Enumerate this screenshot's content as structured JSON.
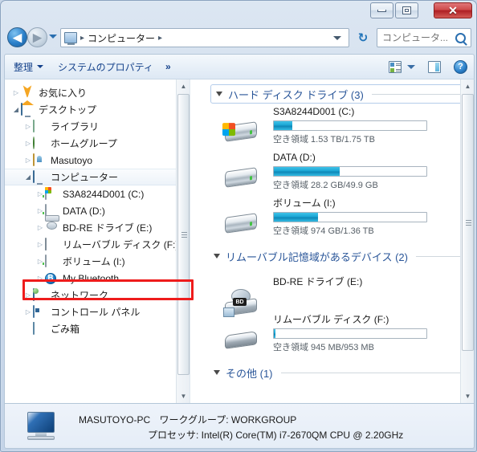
{
  "window": {
    "minimize_label": "",
    "maximize_label": "",
    "close_label": "✕"
  },
  "nav": {
    "back_glyph": "◀",
    "forward_glyph": "▶",
    "breadcrumb_root": "コンピューター",
    "crumb_sep": "▸",
    "refresh_glyph": "↻",
    "pc_icon": "computer-icon"
  },
  "search": {
    "placeholder": "コンピュータ...",
    "value": ""
  },
  "toolbar": {
    "organize_label": "整理",
    "system_properties_label": "システムのプロパティ",
    "overflow_label": "»",
    "help_label": "?",
    "view_icon": "view-options-icon",
    "preview_icon": "preview-pane-icon"
  },
  "sidebar": {
    "items": [
      {
        "label": "お気に入り",
        "indent": 0,
        "twisty": "collapsed",
        "icon": "favorites-star-icon",
        "selected": false
      },
      {
        "label": "デスクトップ",
        "indent": 0,
        "twisty": "expanded",
        "icon": "desktop-monitor-icon",
        "selected": false
      },
      {
        "label": "ライブラリ",
        "indent": 1,
        "twisty": "collapsed",
        "icon": "libraries-folder-icon",
        "selected": false
      },
      {
        "label": "ホームグループ",
        "indent": 1,
        "twisty": "collapsed",
        "icon": "homegroup-icon",
        "selected": false
      },
      {
        "label": "Masutoyo",
        "indent": 1,
        "twisty": "collapsed",
        "icon": "user-folder-icon",
        "selected": false
      },
      {
        "label": "コンピューター",
        "indent": 1,
        "twisty": "expanded",
        "icon": "computer-icon",
        "selected": true
      },
      {
        "label": "S3A8244D001 (C:)",
        "indent": 2,
        "twisty": "collapsed",
        "icon": "windows-drive-icon",
        "selected": false
      },
      {
        "label": "DATA (D:)",
        "indent": 2,
        "twisty": "collapsed",
        "icon": "hard-drive-icon",
        "selected": false
      },
      {
        "label": "BD-RE ドライブ (E:)",
        "indent": 2,
        "twisty": "collapsed",
        "icon": "optical-drive-icon",
        "selected": false
      },
      {
        "label": "リムーバブル ディスク (F:)",
        "indent": 2,
        "twisty": "collapsed",
        "icon": "removable-disk-icon",
        "selected": false,
        "highlighted": true
      },
      {
        "label": "ボリューム (I:)",
        "indent": 2,
        "twisty": "collapsed",
        "icon": "hard-drive-icon",
        "selected": false
      },
      {
        "label": "My Bluetooth",
        "indent": 2,
        "twisty": "collapsed",
        "icon": "bluetooth-icon",
        "selected": false
      },
      {
        "label": "ネットワーク",
        "indent": 1,
        "twisty": "collapsed",
        "icon": "network-icon",
        "selected": false
      },
      {
        "label": "コントロール パネル",
        "indent": 1,
        "twisty": "collapsed",
        "icon": "control-panel-icon",
        "selected": false
      },
      {
        "label": "ごみ箱",
        "indent": 1,
        "twisty": "none",
        "icon": "recycle-bin-icon",
        "selected": false
      }
    ]
  },
  "content": {
    "groups": [
      {
        "title": "ハード ディスク ドライブ (3)",
        "drives": [
          {
            "name": "S3A8244D001 (C:)",
            "free_text": "空き領域 1.53 TB/1.75 TB",
            "used_percent": 12,
            "icon": "windows-hard-drive-icon",
            "has_bar": true
          },
          {
            "name": "DATA (D:)",
            "free_text": "空き領域 28.2 GB/49.9 GB",
            "used_percent": 43,
            "icon": "hard-drive-icon",
            "has_bar": true
          },
          {
            "name": "ボリューム (I:)",
            "free_text": "空き領域 974 GB/1.36 TB",
            "used_percent": 29,
            "icon": "hard-drive-icon",
            "has_bar": true
          }
        ]
      },
      {
        "title": "リムーバブル記憶域があるデバイス (2)",
        "drives": [
          {
            "name": "BD-RE ドライブ (E:)",
            "free_text": "",
            "used_percent": 0,
            "icon": "bd-re-drive-icon",
            "has_bar": false,
            "bd_tag": "BD"
          },
          {
            "name": "リムーバブル ディスク (F:)",
            "free_text": "空き領域 945 MB/953 MB",
            "used_percent": 1,
            "icon": "removable-disk-icon",
            "has_bar": true
          }
        ]
      },
      {
        "title": "その他 (1)",
        "drives": []
      }
    ]
  },
  "status": {
    "computer_name": "MASUTOYO-PC",
    "workgroup_line": "ワークグループ: WORKGROUP",
    "processor_line": "プロセッサ: Intel(R) Core(TM) i7-2670QM CPU @ 2.20GHz"
  },
  "colors": {
    "group_header": "#2a5699",
    "annotation_red": "#ee1c1c",
    "bar_fill": "#1aa6d4",
    "close_button": "#ae1f24"
  }
}
